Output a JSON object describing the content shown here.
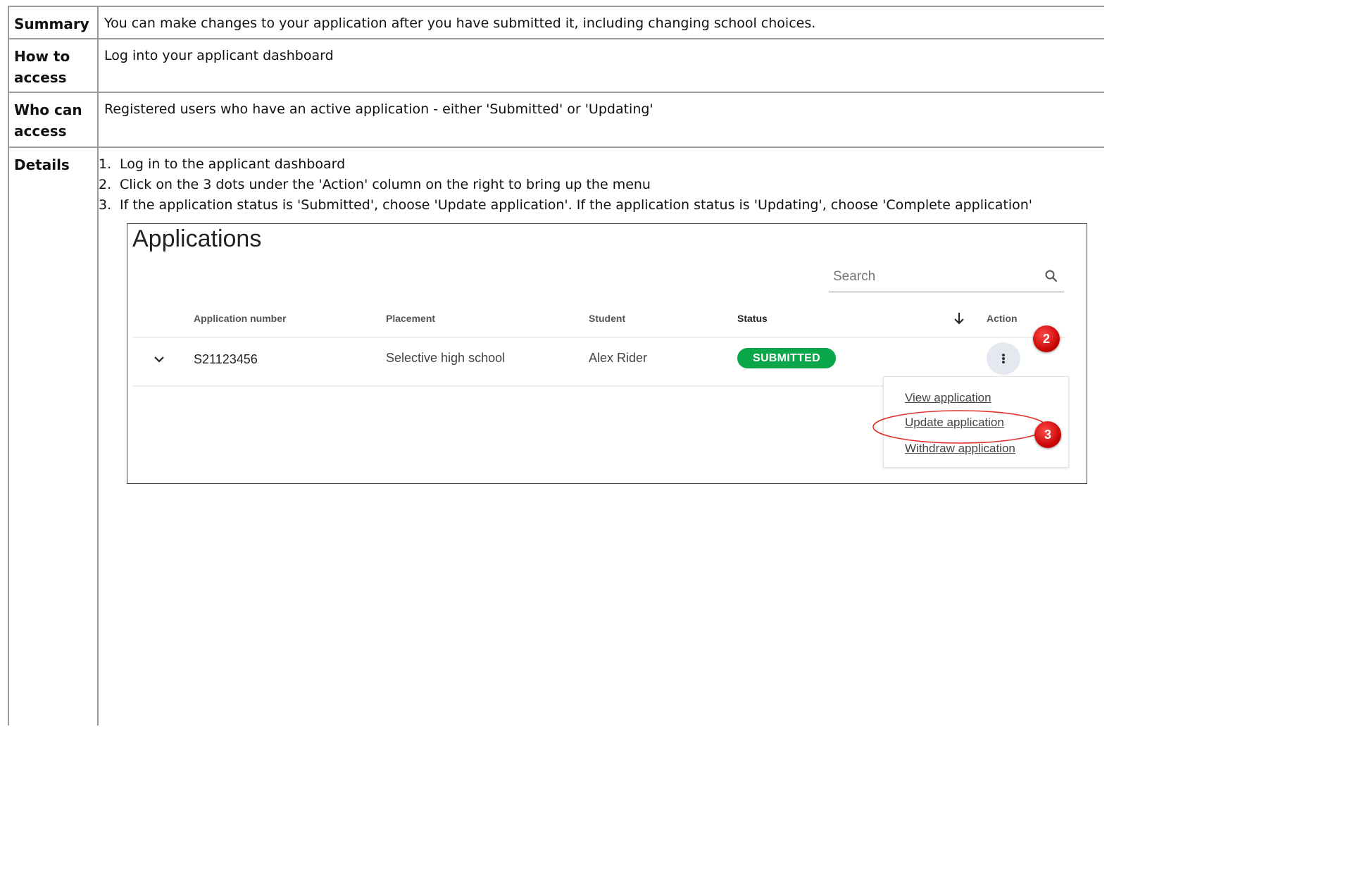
{
  "rows": {
    "summary": {
      "label": "Summary",
      "value": "You can make changes to your application after you have submitted it, including changing school choices."
    },
    "how_to_access": {
      "label": "How to access",
      "value": "Log into your applicant dashboard"
    },
    "who_can_access": {
      "label": "Who can access",
      "value": "Registered users who have an active application - either 'Submitted' or 'Updating'"
    },
    "details": {
      "label": "Details",
      "steps": [
        {
          "num": "1.",
          "text": "Log in to the applicant dashboard"
        },
        {
          "num": "2.",
          "text": "Click on the 3 dots under the 'Action' column on the right to bring up the menu"
        },
        {
          "num": "3.",
          "text": "If the application status is 'Submitted', choose 'Update application'. If the application status is 'Updating', choose 'Complete application'"
        }
      ]
    }
  },
  "screenshot": {
    "title": "Applications",
    "search_placeholder": "Search",
    "columns": [
      "Application number",
      "Placement",
      "Student",
      "Status",
      "Action"
    ],
    "row": {
      "application_number": "S21123456",
      "placement": "Selective high school",
      "student": "Alex Rider",
      "status": "SUBMITTED"
    },
    "menu": [
      "View application",
      "Update application",
      "Withdraw application"
    ],
    "markers": [
      "2",
      "3"
    ],
    "status_color": "#0aa64a",
    "marker_color": "#d40000"
  }
}
